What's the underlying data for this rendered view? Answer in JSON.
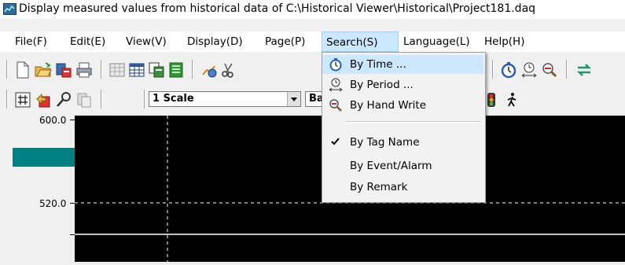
{
  "window": {
    "title": "Display measured values from historical data of C:\\Historical Viewer\\Historical\\Project181.daq"
  },
  "menubar": {
    "items": [
      {
        "label": "File(F)"
      },
      {
        "label": "Edit(E)"
      },
      {
        "label": "View(V)"
      },
      {
        "label": "Display(D)"
      },
      {
        "label": "Page(P)"
      },
      {
        "label": "Search(S)",
        "active": true
      },
      {
        "label": "Language(L)"
      },
      {
        "label": "Help(H)"
      }
    ]
  },
  "search_menu": {
    "items": [
      {
        "label": "By Time ...",
        "icon": "stopwatch-icon"
      },
      {
        "label": "By Period ...",
        "icon": "period-clock-icon"
      },
      {
        "label": "By Hand Write",
        "icon": "magnifier-icon"
      },
      {
        "label": "By Tag Name",
        "checked": true
      },
      {
        "label": "By Event/Alarm"
      },
      {
        "label": "By Remark"
      }
    ]
  },
  "toolbar2": {
    "scale_combo_value": "1 Scale",
    "second_combo_value": "Ba"
  },
  "chart": {
    "y_tick_top": "600.0",
    "y_tick_mid": "520.0"
  },
  "colors": {
    "plot_background": "#000000",
    "bar_color": "#008080",
    "menu_highlight": "#cce8ff"
  }
}
